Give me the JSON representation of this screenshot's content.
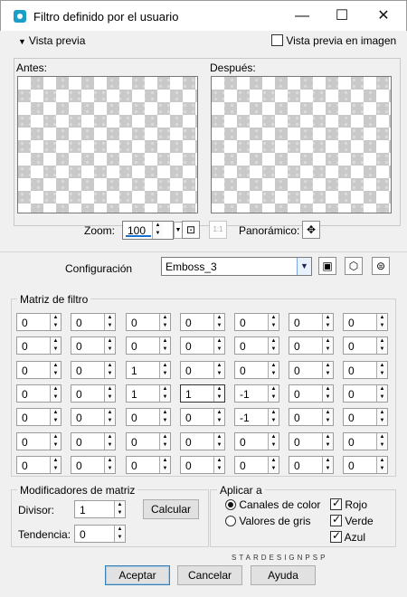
{
  "window": {
    "title": "Filtro definido por el usuario",
    "minimize": "—",
    "maximize": "☐",
    "close": "✕"
  },
  "preview": {
    "toggle_label": "Vista previa",
    "image_preview_label": "Vista previa en imagen",
    "image_preview_checked": false,
    "before_label": "Antes:",
    "after_label": "Después:"
  },
  "zoom": {
    "label": "Zoom:",
    "value": "100",
    "panoramic_label": "Panorámico:"
  },
  "config": {
    "label": "Configuración",
    "value": "Emboss_3"
  },
  "matrix": {
    "title": "Matriz de filtro",
    "rows": [
      [
        "0",
        "0",
        "0",
        "0",
        "0",
        "0",
        "0"
      ],
      [
        "0",
        "0",
        "0",
        "0",
        "0",
        "0",
        "0"
      ],
      [
        "0",
        "0",
        "1",
        "0",
        "0",
        "0",
        "0"
      ],
      [
        "0",
        "0",
        "1",
        "1",
        "-1",
        "0",
        "0"
      ],
      [
        "0",
        "0",
        "0",
        "0",
        "-1",
        "0",
        "0"
      ],
      [
        "0",
        "0",
        "0",
        "0",
        "0",
        "0",
        "0"
      ],
      [
        "0",
        "0",
        "0",
        "0",
        "0",
        "0",
        "0"
      ]
    ]
  },
  "modifiers": {
    "title": "Modificadores de matriz",
    "divisor_label": "Divisor:",
    "divisor_value": "1",
    "bias_label": "Tendencia:",
    "bias_value": "0",
    "calculate_label": "Calcular"
  },
  "apply": {
    "title": "Aplicar a",
    "color_channels": "Canales de color",
    "gray_values": "Valores de gris",
    "red": "Rojo",
    "green": "Verde",
    "blue": "Azul"
  },
  "watermark": "STARDESIGNPSP",
  "buttons": {
    "ok": "Aceptar",
    "cancel": "Cancelar",
    "help": "Ayuda"
  }
}
